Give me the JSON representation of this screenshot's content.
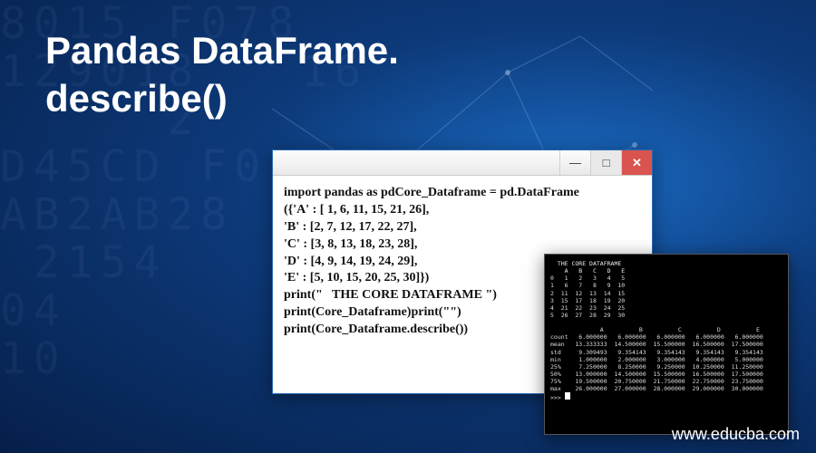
{
  "page": {
    "title_line1": "Pandas DataFrame.",
    "title_line2": "describe()"
  },
  "code_window": {
    "titlebar": {
      "minimize_label": "—",
      "maximize_label": "□",
      "close_label": "✕"
    },
    "code": "import pandas as pdCore_Dataframe = pd.DataFrame\n({'A' : [ 1, 6, 11, 15, 21, 26],\n'B' : [2, 7, 12, 17, 22, 27],\n'C' : [3, 8, 13, 18, 23, 28],\n'D' : [4, 9, 14, 19, 24, 29],\n'E' : [5, 10, 15, 20, 25, 30]})\nprint(\"   THE CORE DATAFRAME \")\nprint(Core_Dataframe)print(\"\")\nprint(Core_Dataframe.describe())"
  },
  "console_window": {
    "top_header": "  THE CORE DATAFRAME\n    A   B   C   D   E",
    "top_rows": "0   1   2   3   4   5\n1   6   7   8   9  10\n2  11  12  13  14  15\n3  15  17  18  19  20\n4  21  22  23  24  25\n5  26  27  28  29  30",
    "blank": "",
    "desc_header": "              A          B          C          D          E",
    "desc_rows": "count   6.000000   6.000000   6.000000   6.000000   6.000000\nmean   13.333333  14.500000  15.500000  16.500000  17.500000\nstd     9.309493   9.354143   9.354143   9.354143   9.354143\nmin     1.000000   2.000000   3.000000   4.000000   5.000000\n25%     7.250000   8.250000   9.250000  10.250000  11.250000\n50%    13.000000  14.500000  15.500000  16.500000  17.500000\n75%    19.500000  20.750000  21.750000  22.750000  23.750000\nmax    26.000000  27.000000  28.000000  29.000000  30.000000",
    "prompt": ">>> "
  },
  "watermark": {
    "text": "www.educba.com"
  },
  "bg": {
    "numbers": "8015 F078\n129018   16\n     2\nD45CD F01\nAB2AB28\n 2154\n04\n10",
    "lines_path": "M300,120 L420,200 L560,80 L620,210 L700,160 M420,200 L480,300 L600,250 L700,320 M560,80 L640,40 L720,100"
  }
}
